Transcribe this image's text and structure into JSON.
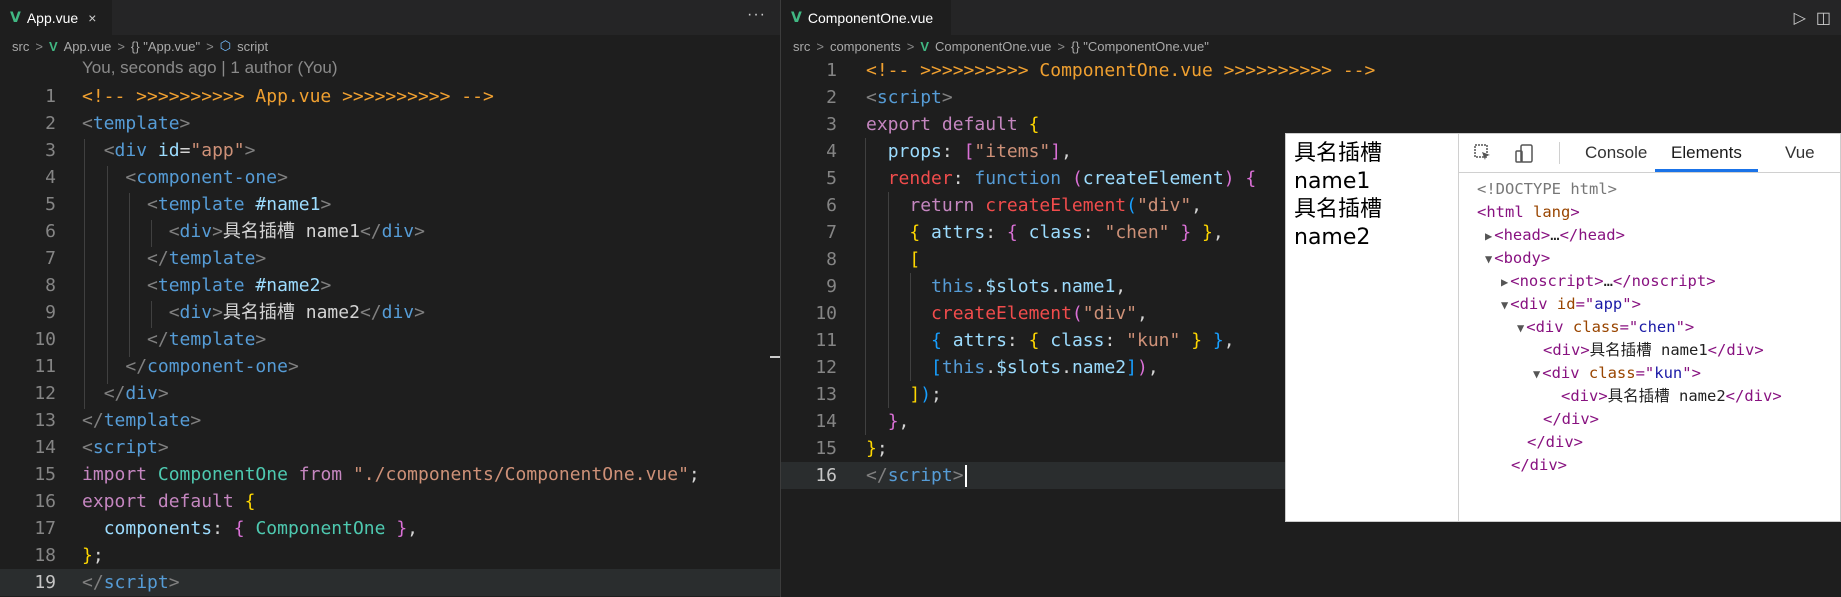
{
  "left": {
    "tab_label": "App.vue",
    "tab_close": "×",
    "more": "···",
    "breadcrumb": [
      "src",
      ">",
      "App.vue",
      ">",
      "{} \"App.vue\"",
      ">",
      "script"
    ],
    "codelens": "You, seconds ago | 1 author (You)",
    "lines": [
      {
        "n": "1",
        "html": "<span class='c-com'>&lt;!-- &gt;&gt;&gt;&gt;&gt;&gt;&gt;&gt;&gt;&gt; App.vue &gt;&gt;&gt;&gt;&gt;&gt;&gt;&gt;&gt;&gt; --&gt;</span>"
      },
      {
        "n": "2",
        "html": "<span class='c-br'>&lt;</span><span class='c-tag'>template</span><span class='c-br'>&gt;</span>"
      },
      {
        "n": "3",
        "html": "  <span class='c-br'>&lt;</span><span class='c-tag'>div</span> <span class='c-attr'>id</span><span class='c-plain'>=</span><span class='c-str'>\"app\"</span><span class='c-br'>&gt;</span>"
      },
      {
        "n": "4",
        "html": "    <span class='c-br'>&lt;</span><span class='c-tag'>component-one</span><span class='c-br'>&gt;</span>"
      },
      {
        "n": "5",
        "html": "      <span class='c-br'>&lt;</span><span class='c-tag'>template</span> <span class='c-attr'>#name1</span><span class='c-br'>&gt;</span>"
      },
      {
        "n": "6",
        "html": "        <span class='c-br'>&lt;</span><span class='c-tag'>div</span><span class='c-br'>&gt;</span><span class='c-plain'>具名插槽 name1</span><span class='c-br'>&lt;/</span><span class='c-tag'>div</span><span class='c-br'>&gt;</span>"
      },
      {
        "n": "7",
        "html": "      <span class='c-br'>&lt;/</span><span class='c-tag'>template</span><span class='c-br'>&gt;</span>"
      },
      {
        "n": "8",
        "html": "      <span class='c-br'>&lt;</span><span class='c-tag'>template</span> <span class='c-attr'>#name2</span><span class='c-br'>&gt;</span>"
      },
      {
        "n": "9",
        "html": "        <span class='c-br'>&lt;</span><span class='c-tag'>div</span><span class='c-br'>&gt;</span><span class='c-plain'>具名插槽 name2</span><span class='c-br'>&lt;/</span><span class='c-tag'>div</span><span class='c-br'>&gt;</span>"
      },
      {
        "n": "10",
        "html": "      <span class='c-br'>&lt;/</span><span class='c-tag'>template</span><span class='c-br'>&gt;</span>"
      },
      {
        "n": "11",
        "html": "    <span class='c-br'>&lt;/</span><span class='c-tag'>component-one</span><span class='c-br'>&gt;</span>"
      },
      {
        "n": "12",
        "html": "  <span class='c-br'>&lt;/</span><span class='c-tag'>div</span><span class='c-br'>&gt;</span>"
      },
      {
        "n": "13",
        "html": "<span class='c-br'>&lt;/</span><span class='c-tag'>template</span><span class='c-br'>&gt;</span>"
      },
      {
        "n": "14",
        "html": "<span class='c-br'>&lt;</span><span class='c-tag'>script</span><span class='c-br'>&gt;</span>"
      },
      {
        "n": "15",
        "html": "<span class='c-kw'>import</span> <span class='c-cls'>ComponentOne</span> <span class='c-kw'>from</span> <span class='c-str'>\"./components/ComponentOne.vue\"</span><span class='c-plain'>;</span>"
      },
      {
        "n": "16",
        "html": "<span class='c-kw'>export</span> <span class='c-kw'>default</span> <span class='c-y'>{</span>"
      },
      {
        "n": "17",
        "html": "  <span class='c-prop'>components</span><span class='c-plain'>: </span><span class='c-p'>{</span> <span class='c-cls'>ComponentOne</span> <span class='c-p'>}</span><span class='c-plain'>,</span>"
      },
      {
        "n": "18",
        "html": "<span class='c-y'>}</span><span class='c-plain'>;</span>"
      },
      {
        "n": "19",
        "html": "<span class='c-br'>&lt;/</span><span class='c-tag'>script</span><span class='c-br'>&gt;</span>"
      }
    ]
  },
  "right": {
    "tab_label": "ComponentOne.vue",
    "breadcrumb": [
      "src",
      ">",
      "components",
      ">",
      "ComponentOne.vue",
      ">",
      "{} \"ComponentOne.vue\""
    ],
    "run_icon": "▷",
    "split_icon": "◫",
    "lines": [
      {
        "n": "1",
        "html": "<span class='c-com'>&lt;!-- &gt;&gt;&gt;&gt;&gt;&gt;&gt;&gt;&gt;&gt; ComponentOne.vue &gt;&gt;&gt;&gt;&gt;&gt;&gt;&gt;&gt;&gt; --&gt;</span>"
      },
      {
        "n": "2",
        "html": "<span class='c-br'>&lt;</span><span class='c-tag'>script</span><span class='c-br'>&gt;</span>"
      },
      {
        "n": "3",
        "html": "<span class='c-kw'>export</span> <span class='c-kw'>default</span> <span class='c-y'>{</span>"
      },
      {
        "n": "4",
        "html": "  <span class='c-prop'>props</span><span class='c-plain'>: </span><span class='c-p'>[</span><span class='c-str'>\"items\"</span><span class='c-p'>]</span><span class='c-plain'>,</span>"
      },
      {
        "n": "5",
        "html": "  <span class='c-red'>render</span><span class='c-plain'>: </span><span class='c-kw2'>function</span> <span class='c-p'>(</span><span class='c-prop'>createElement</span><span class='c-p'>)</span> <span class='c-p'>{</span>"
      },
      {
        "n": "6",
        "html": "    <span class='c-kw'>return</span> <span class='c-red'>createElement</span><span class='c-b'>(</span><span class='c-str'>\"div\"</span><span class='c-plain'>,</span>"
      },
      {
        "n": "7",
        "html": "    <span class='c-y'>{</span> <span class='c-prop'>attrs</span><span class='c-plain'>: </span><span class='c-p'>{</span> <span class='c-prop'>class</span><span class='c-plain'>: </span><span class='c-str'>\"chen\"</span> <span class='c-p'>}</span> <span class='c-y'>}</span><span class='c-plain'>,</span>"
      },
      {
        "n": "8",
        "html": "    <span class='c-y'>[</span>"
      },
      {
        "n": "9",
        "html": "      <span class='c-kw2'>this</span><span class='c-plain'>.</span><span class='c-prop'>$slots</span><span class='c-plain'>.</span><span class='c-prop'>name1</span><span class='c-plain'>,</span>"
      },
      {
        "n": "10",
        "html": "      <span class='c-red'>createElement</span><span class='c-p'>(</span><span class='c-str'>\"div\"</span><span class='c-plain'>,</span>"
      },
      {
        "n": "11",
        "html": "      <span class='c-b'>{</span> <span class='c-prop'>attrs</span><span class='c-plain'>: </span><span class='c-y'>{</span> <span class='c-prop'>class</span><span class='c-plain'>: </span><span class='c-str'>\"kun\"</span> <span class='c-y'>}</span> <span class='c-b'>}</span><span class='c-plain'>,</span>"
      },
      {
        "n": "12",
        "html": "      <span class='c-b'>[</span><span class='c-kw2'>this</span><span class='c-plain'>.</span><span class='c-prop'>$slots</span><span class='c-plain'>.</span><span class='c-prop'>name2</span><span class='c-b'>]</span><span class='c-p'>)</span><span class='c-plain'>,</span>"
      },
      {
        "n": "13",
        "html": "    <span class='c-y'>]</span><span class='c-b'>)</span><span class='c-plain'>;</span>"
      },
      {
        "n": "14",
        "html": "  <span class='c-p'>}</span><span class='c-plain'>,</span>"
      },
      {
        "n": "15",
        "html": "<span class='c-y'>}</span><span class='c-plain'>;</span>"
      },
      {
        "n": "16",
        "html": "<span class='c-br'>&lt;/</span><span class='c-tag'>script</span><span class='c-br'>&gt;</span><span class='cursor'></span>"
      }
    ]
  },
  "browser": {
    "rendered_lines": [
      "具名插槽",
      "name1",
      "具名插槽",
      "name2"
    ],
    "devtools_tabs": [
      "Console",
      "Elements",
      "Vue"
    ],
    "active_tab": "Elements",
    "dom": [
      {
        "html": "<span class='d-doc'>&lt;!DOCTYPE html&gt;</span>"
      },
      {
        "html": "<span class='d-tag'>&lt;html</span> <span class='d-attr'>lang</span><span class='d-tag'>&gt;</span>"
      },
      {
        "html": "<span class='tri'>▶</span><span class='d-tag'>&lt;head&gt;</span><span class='d-txt'>…</span><span class='d-tag'>&lt;/head&gt;</span>"
      },
      {
        "html": "<span class='tri'>▼</span><span class='d-tag'>&lt;body&gt;</span>"
      },
      {
        "html": "<span class='tri'>▶</span><span class='d-tag'>&lt;noscript&gt;</span><span class='d-txt'>…</span><span class='d-tag'>&lt;/noscript&gt;</span>"
      },
      {
        "html": "<span class='tri'>▼</span><span class='d-tag'>&lt;div</span> <span class='d-attr'>id</span><span class='d-tag'>=\"</span><span class='d-val'>app</span><span class='d-tag'>\"&gt;</span>"
      },
      {
        "html": "<span class='tri'>▼</span><span class='d-tag'>&lt;div</span> <span class='d-attr'>class</span><span class='d-tag'>=\"</span><span class='d-val'>chen</span><span class='d-tag'>\"&gt;</span>"
      },
      {
        "html": "<span class='d-tag'>&lt;div&gt;</span><span class='d-txt'>具名插槽 name1</span><span class='d-tag'>&lt;/div&gt;</span>"
      },
      {
        "html": "<span class='tri'>▼</span><span class='d-tag'>&lt;div</span> <span class='d-attr'>class</span><span class='d-tag'>=\"</span><span class='d-val'>kun</span><span class='d-tag'>\"&gt;</span>"
      },
      {
        "html": "<span class='d-tag'>&lt;div&gt;</span><span class='d-txt'>具名插槽 name2</span><span class='d-tag'>&lt;/div&gt;</span>"
      },
      {
        "html": "<span class='d-tag'>&lt;/div&gt;</span>"
      },
      {
        "html": "<span class='d-tag'>&lt;/div&gt;</span>"
      },
      {
        "html": "<span class='d-tag'>&lt;/div&gt;</span>"
      }
    ]
  }
}
